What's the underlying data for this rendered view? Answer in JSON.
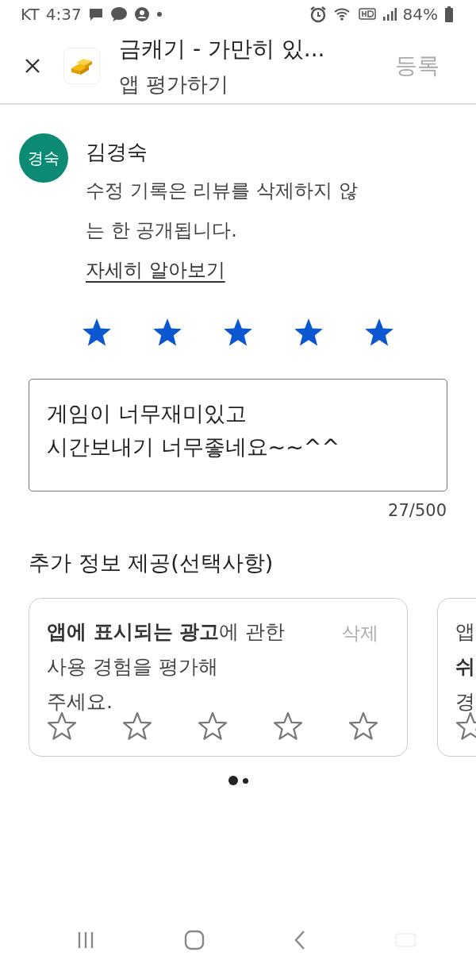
{
  "status_bar": {
    "carrier": "KT",
    "time": "4:37",
    "battery": "84%"
  },
  "header": {
    "title": "금캐기 - 가만히 있...",
    "subtitle": "앱 평가하기",
    "submit": {
      "label": "등록",
      "disabled": true
    }
  },
  "reviewer": {
    "avatar": "경숙",
    "name": "김경숙",
    "notice": "수정 기록은 리뷰를 삭제하지 않는 한 공개됩니다.",
    "link": "자세히 알아보기"
  },
  "rating": {
    "stars": 5
  },
  "review": {
    "value": "게임이 너무재미있고\n시간보내기 너무좋네요~~^^",
    "counter": "27/500"
  },
  "section_title": "추가 정보 제공(선택사항)",
  "cards": [
    {
      "lines": [
        "**앱에 표시되는 광고**에 관한",
        "사용 경험을 평가해",
        "주세요."
      ],
      "delete": "삭제",
      "stars": 0
    },
    {
      "lines": [
        "앱",
        "**쉬**",
        "경"
      ]
    }
  ],
  "pager": [
    {
      "selected": true
    },
    {
      "selected": false
    }
  ]
}
